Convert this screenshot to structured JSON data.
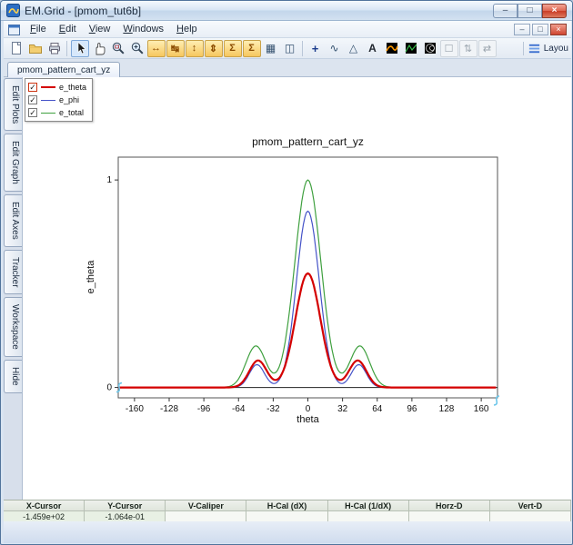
{
  "window": {
    "title": "EM.Grid - [pmom_tut6b]",
    "controls": {
      "minimize": "–",
      "maximize": "□",
      "close": "×"
    }
  },
  "menubar": {
    "items": [
      "File",
      "Edit",
      "View",
      "Windows",
      "Help"
    ],
    "mdi_controls": {
      "minimize": "–",
      "restore": "□",
      "close": "×"
    }
  },
  "toolbar": {
    "layout_label": "Layou",
    "items": [
      {
        "name": "new-document-icon",
        "type": "svg",
        "shape": "page"
      },
      {
        "name": "open-folder-icon",
        "type": "svg",
        "shape": "folder"
      },
      {
        "name": "print-icon",
        "type": "svg",
        "shape": "printer"
      },
      {
        "name": "toolbar-separator",
        "type": "sep"
      },
      {
        "name": "select-tool-icon",
        "type": "svg",
        "shape": "cursor",
        "active": true
      },
      {
        "name": "pan-tool-icon",
        "type": "svg",
        "shape": "hand"
      },
      {
        "name": "zoom-window-icon",
        "type": "svg",
        "shape": "magwin"
      },
      {
        "name": "zoom-in-icon",
        "type": "svg",
        "shape": "magplus"
      },
      {
        "name": "fit-width-icon",
        "type": "glyph",
        "glyph": "↔",
        "style": "orange"
      },
      {
        "name": "fit-x-limits-icon",
        "type": "glyph",
        "glyph": "↹",
        "style": "orange"
      },
      {
        "name": "fit-height-icon",
        "type": "glyph",
        "glyph": "↕",
        "style": "orange"
      },
      {
        "name": "fit-y-limits-icon",
        "type": "glyph",
        "glyph": "⇕",
        "style": "orange"
      },
      {
        "name": "autoscale-icon",
        "type": "glyph",
        "glyph": "Σ",
        "style": "orange"
      },
      {
        "name": "autoscale-all-icon",
        "type": "glyph",
        "glyph": "Σ",
        "style": "orange"
      },
      {
        "name": "table-view-icon",
        "type": "glyph",
        "glyph": "▦",
        "style": "plain"
      },
      {
        "name": "graph-view-icon",
        "type": "glyph",
        "glyph": "◫",
        "style": "plain"
      },
      {
        "name": "toolbar-separator",
        "type": "sep"
      },
      {
        "name": "add-curve-icon",
        "type": "glyph",
        "glyph": "+",
        "style": "blue"
      },
      {
        "name": "line-plot-icon",
        "type": "glyph",
        "glyph": "∿",
        "style": "plain"
      },
      {
        "name": "marker-plot-icon",
        "type": "glyph",
        "glyph": "△",
        "style": "plain"
      },
      {
        "name": "text-label-icon",
        "type": "glyph",
        "glyph": "A",
        "style": "text"
      },
      {
        "name": "colormap-icon",
        "type": "svg",
        "shape": "colormap"
      },
      {
        "name": "dark-plot-icon",
        "type": "svg",
        "shape": "darkplot"
      },
      {
        "name": "smith-chart-icon",
        "type": "svg",
        "shape": "darkarcs"
      },
      {
        "name": "layers-toggle-icon",
        "type": "glyph",
        "glyph": "☐",
        "style": "gray"
      },
      {
        "name": "sync-vertical-icon",
        "type": "glyph",
        "glyph": "⇅",
        "style": "gray"
      },
      {
        "name": "sync-horizontal-icon",
        "type": "glyph",
        "glyph": "⇄",
        "style": "gray"
      }
    ]
  },
  "tabbar": {
    "tabs": [
      {
        "label": "pmom_pattern_cart_yz",
        "active": true
      }
    ]
  },
  "side_tabs": {
    "items": [
      "Edit Plots",
      "Edit Graph",
      "Edit Axes",
      "Tracker",
      "Workspace",
      "Hide"
    ]
  },
  "legend": {
    "items": [
      {
        "label": "e_theta",
        "color": "#d40000",
        "checked": true,
        "focused": true
      },
      {
        "label": "e_phi",
        "color": "#4553c8",
        "checked": true,
        "focused": false
      },
      {
        "label": "e_total",
        "color": "#3fa03f",
        "checked": true,
        "focused": false
      }
    ]
  },
  "chart_data": {
    "type": "line",
    "title": "pmom_pattern_cart_yz",
    "xlabel": "theta",
    "ylabel": "e_theta",
    "xlim": [
      -175,
      175
    ],
    "ylim": [
      -0.05,
      1.11
    ],
    "x_ticks": [
      -160,
      -128,
      -96,
      -64,
      -32,
      0,
      32,
      64,
      96,
      128,
      160
    ],
    "y_ticks": [
      0,
      1
    ],
    "grid": false,
    "legend_position": "top-left",
    "series": [
      {
        "name": "e_total",
        "color": "#3fa03f",
        "line_width": 1.2,
        "peak_model": [
          {
            "amp": 1.0,
            "center": 0,
            "sigma": 12
          },
          {
            "amp": 0.2,
            "center": -48,
            "sigma": 9
          },
          {
            "amp": 0.2,
            "center": 48,
            "sigma": 9
          }
        ]
      },
      {
        "name": "e_phi",
        "color": "#4553c8",
        "line_width": 1.2,
        "peak_model": [
          {
            "amp": 0.85,
            "center": 0,
            "sigma": 10.5
          },
          {
            "amp": 0.11,
            "center": -47,
            "sigma": 7
          },
          {
            "amp": 0.11,
            "center": 47,
            "sigma": 7
          }
        ]
      },
      {
        "name": "e_theta",
        "color": "#d40000",
        "line_width": 2.2,
        "peak_model": [
          {
            "amp": 0.55,
            "center": 0,
            "sigma": 11.5
          },
          {
            "amp": 0.13,
            "center": -46,
            "sigma": 8
          },
          {
            "amp": 0.13,
            "center": 46,
            "sigma": 8
          }
        ]
      }
    ],
    "key_points": {
      "main_lobe_peak_x": 0,
      "main_lobe_peaks": {
        "e_theta": 0.55,
        "e_phi": 0.85,
        "e_total": 1.0
      },
      "sidelobe_center_deg": 47,
      "sidelobe_peaks": {
        "e_theta": 0.13,
        "e_phi": 0.11,
        "e_total": 0.2
      },
      "baseline_value": 0
    }
  },
  "status_bar": {
    "columns": [
      {
        "header": "X-Cursor",
        "value": "-1.459e+02"
      },
      {
        "header": "Y-Cursor",
        "value": "-1.064e-01"
      },
      {
        "header": "V-Caliper",
        "value": ""
      },
      {
        "header": "H-Cal (dX)",
        "value": ""
      },
      {
        "header": "H-Cal (1/dX)",
        "value": ""
      },
      {
        "header": "Horz-D",
        "value": ""
      },
      {
        "header": "Vert-D",
        "value": ""
      }
    ]
  }
}
